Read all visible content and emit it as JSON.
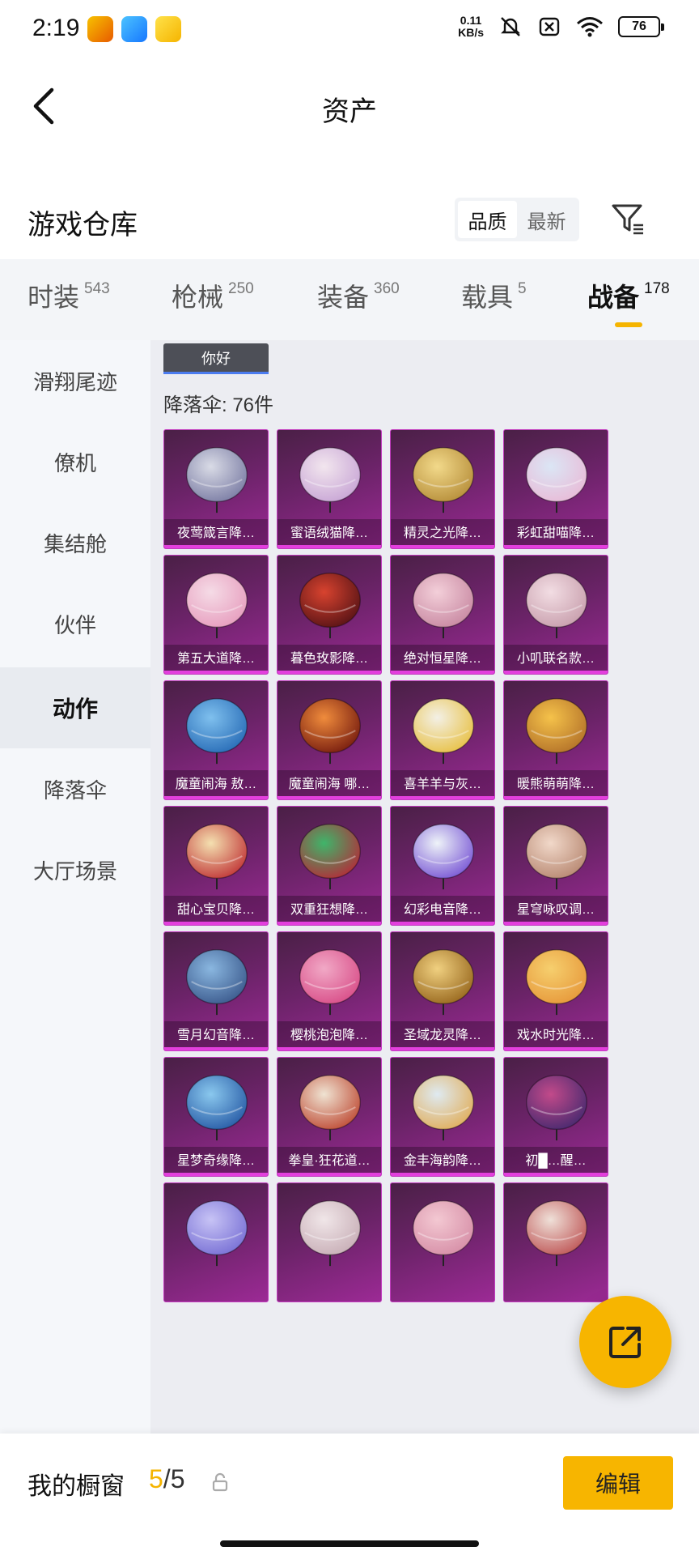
{
  "status": {
    "time": "2:19",
    "net_speed_value": "0.11",
    "net_speed_unit": "KB/s",
    "battery": "76"
  },
  "nav": {
    "title": "资产"
  },
  "warehouse": {
    "title": "游戏仓库",
    "sort_quality": "品质",
    "sort_newest": "最新"
  },
  "categories": [
    {
      "label": "时装",
      "count": "543"
    },
    {
      "label": "枪械",
      "count": "250"
    },
    {
      "label": "装备",
      "count": "360"
    },
    {
      "label": "载具",
      "count": "5"
    },
    {
      "label": "战备",
      "count": "178"
    }
  ],
  "sidebar": [
    {
      "label": "滑翔尾迹"
    },
    {
      "label": "僚机"
    },
    {
      "label": "集结舱"
    },
    {
      "label": "伙伴"
    },
    {
      "label": "动作"
    },
    {
      "label": "降落伞"
    },
    {
      "label": "大厅场景"
    }
  ],
  "content": {
    "tag": "你好",
    "count_label": "降落伞: 76件",
    "items": [
      {
        "name": "夜莺箴言降…"
      },
      {
        "name": "蜜语绒猫降…"
      },
      {
        "name": "精灵之光降…"
      },
      {
        "name": "彩虹甜喵降…"
      },
      {
        "name": "第五大道降…"
      },
      {
        "name": "暮色玫影降…"
      },
      {
        "name": "绝对恒星降…"
      },
      {
        "name": "小叽联名款…"
      },
      {
        "name": "魔童闹海 敖…"
      },
      {
        "name": "魔童闹海 哪…"
      },
      {
        "name": "喜羊羊与灰…"
      },
      {
        "name": "暖熊萌萌降…"
      },
      {
        "name": "甜心宝贝降…"
      },
      {
        "name": "双重狂想降…"
      },
      {
        "name": "幻彩电音降…"
      },
      {
        "name": "星穹咏叹调…"
      },
      {
        "name": "雪月幻音降…"
      },
      {
        "name": "樱桃泡泡降…"
      },
      {
        "name": "圣域龙灵降…"
      },
      {
        "name": "戏水时光降…"
      },
      {
        "name": "星梦奇缘降…"
      },
      {
        "name": "拳皇·狂花道…"
      },
      {
        "name": "金丰海韵降…"
      },
      {
        "name": "初█…醒…"
      },
      {
        "name": ""
      },
      {
        "name": ""
      },
      {
        "name": ""
      },
      {
        "name": ""
      }
    ]
  },
  "bottom": {
    "label": "我的橱窗",
    "current": "5",
    "total": "/5",
    "edit": "编辑"
  },
  "colors": {
    "accent": "#f7b500",
    "card_border": "#e33fdd"
  }
}
